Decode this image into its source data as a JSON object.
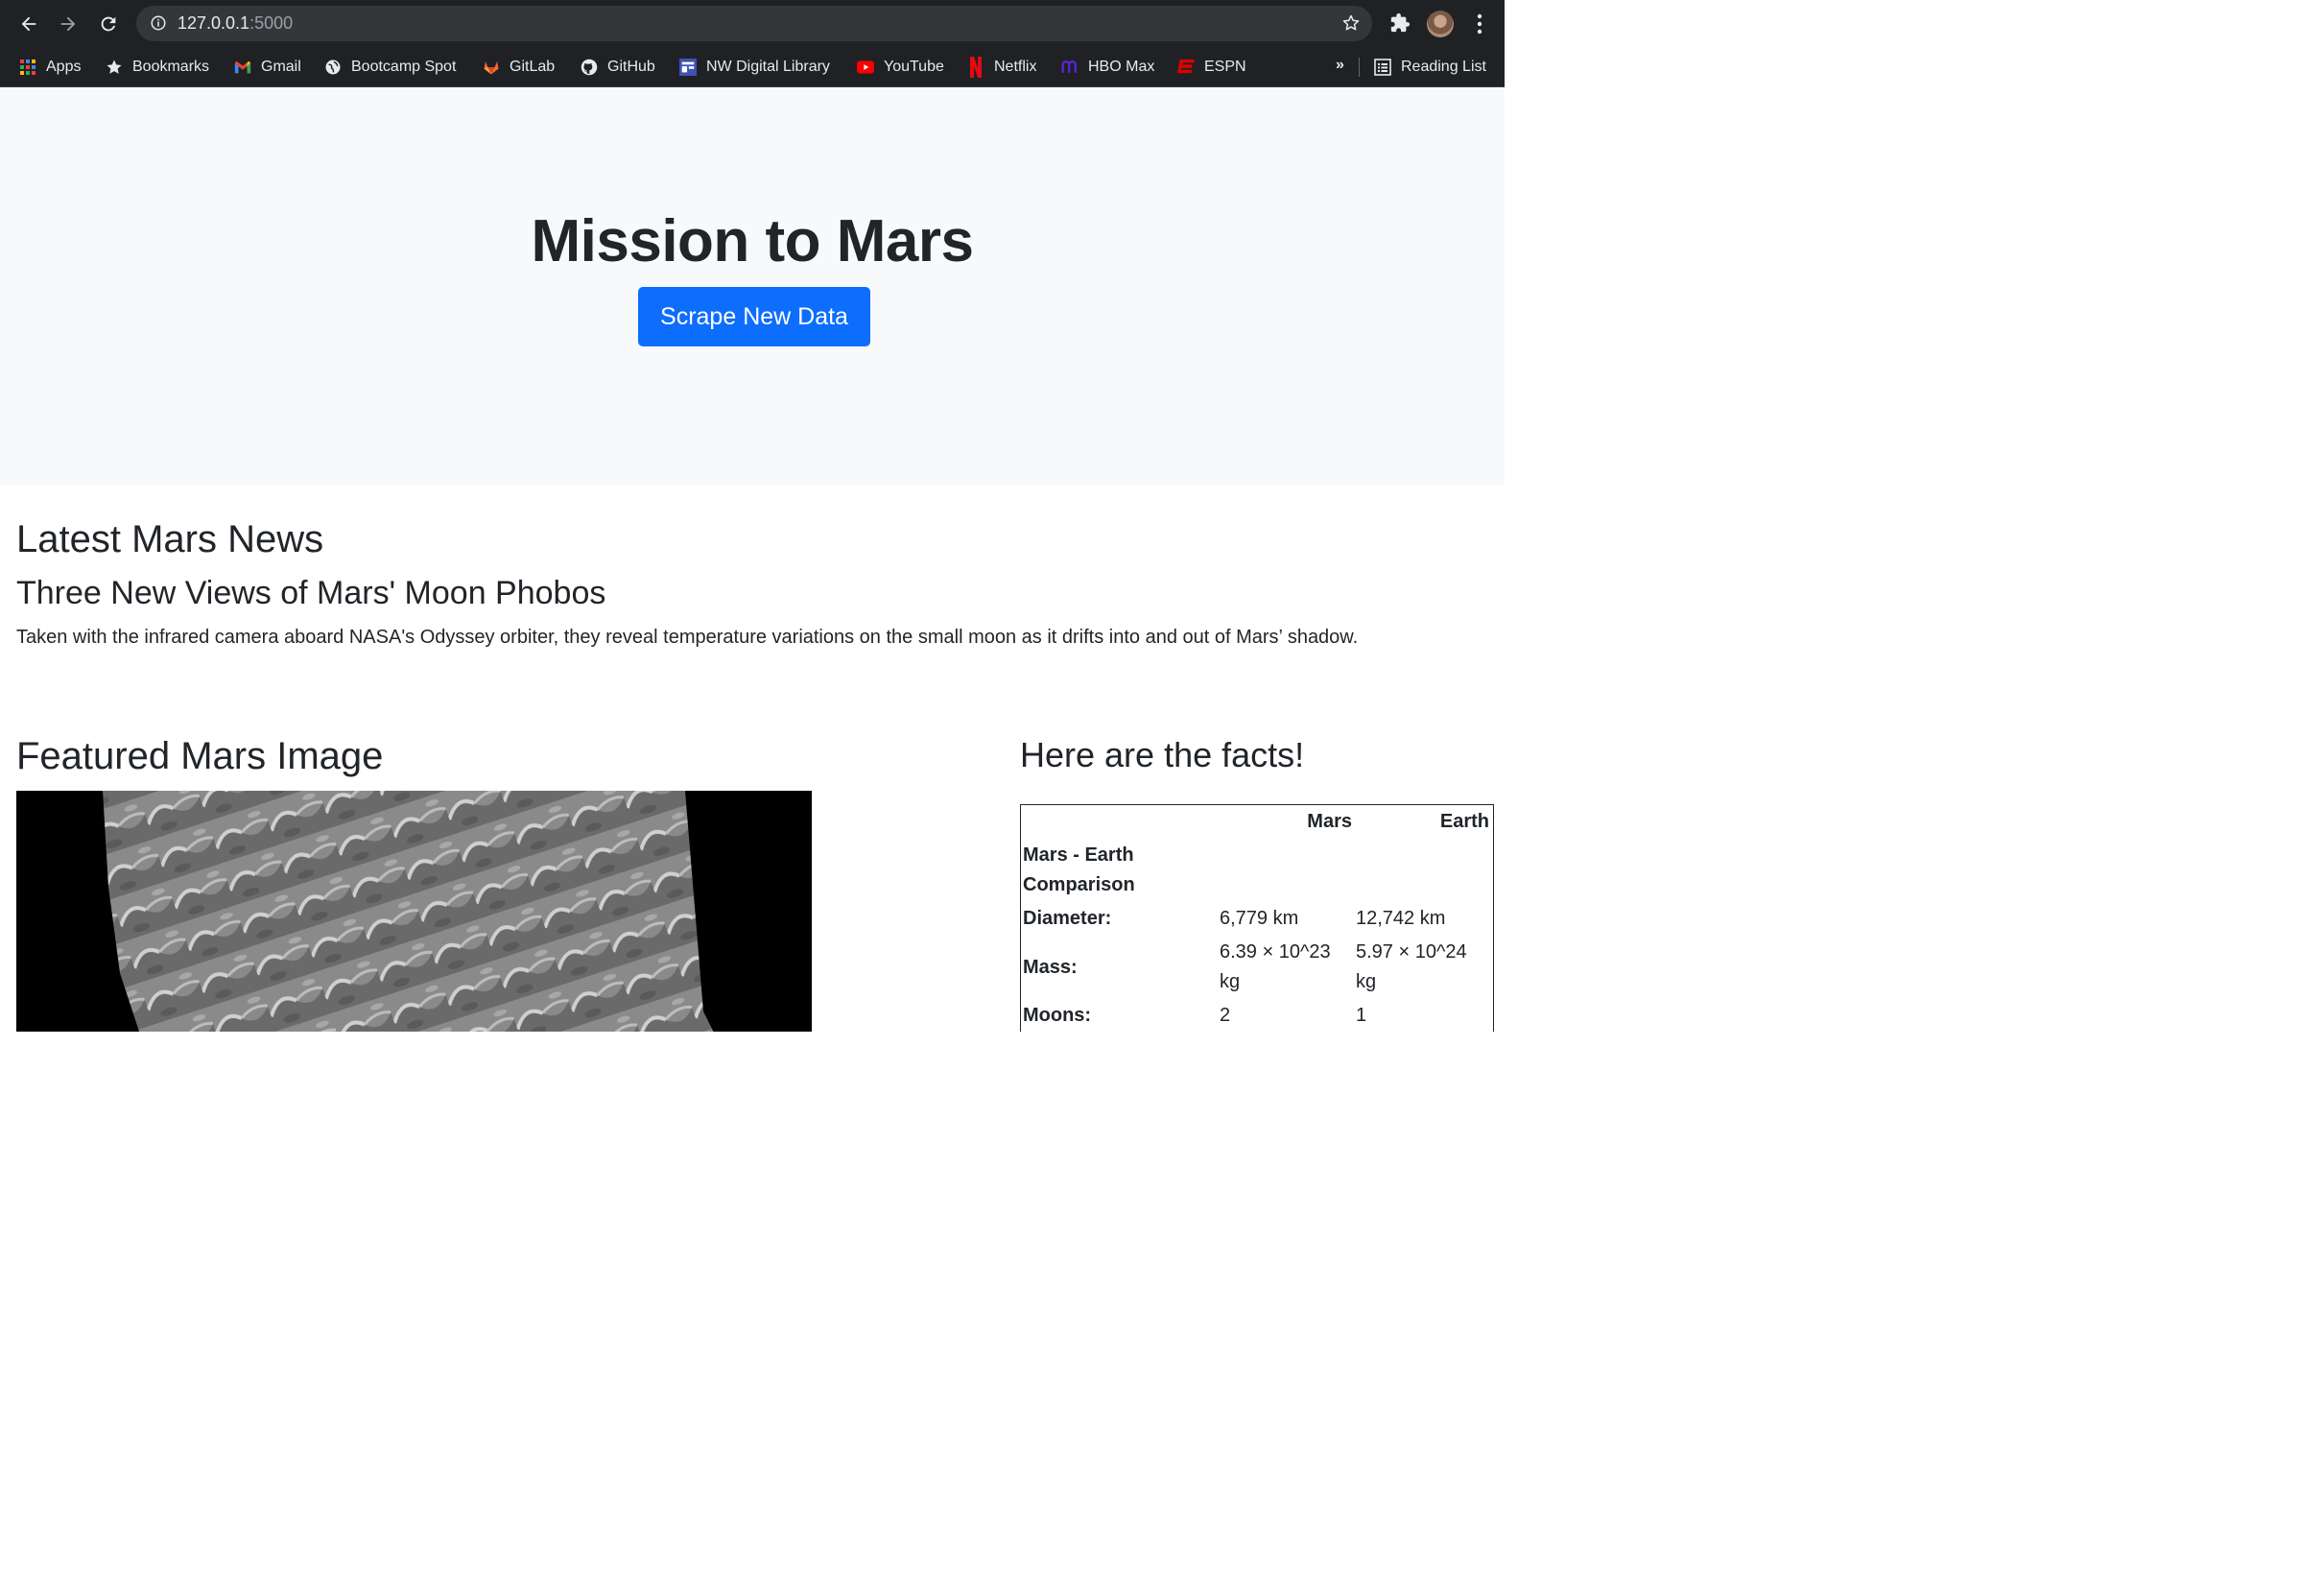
{
  "browser": {
    "url_host": "127.0.0.1",
    "url_port": ":5000",
    "bookmarks": [
      {
        "label": "Apps",
        "icon": "apps-grid-icon"
      },
      {
        "label": "Bookmarks",
        "icon": "star-icon"
      },
      {
        "label": "Gmail",
        "icon": "gmail-icon"
      },
      {
        "label": "Bootcamp Spot",
        "icon": "globe-icon"
      },
      {
        "label": "GitLab",
        "icon": "gitlab-icon"
      },
      {
        "label": "GitHub",
        "icon": "github-icon"
      },
      {
        "label": "NW Digital Library",
        "icon": "library-icon"
      },
      {
        "label": "YouTube",
        "icon": "youtube-icon"
      },
      {
        "label": "Netflix",
        "icon": "netflix-icon"
      },
      {
        "label": "HBO Max",
        "icon": "hbomax-icon"
      },
      {
        "label": "ESPN",
        "icon": "espn-icon"
      }
    ],
    "more_label": "»",
    "reading_list_label": "Reading List"
  },
  "page": {
    "title": "Mission to Mars",
    "scrape_button": "Scrape New Data",
    "news": {
      "heading": "Latest Mars News",
      "title": "Three New Views of Mars' Moon Phobos",
      "teaser": "Taken with the infrared camera aboard NASA's Odyssey orbiter, they reveal temperature variations on the small moon as it drifts into and out of Mars’ shadow."
    },
    "featured_image": {
      "heading": "Featured Mars Image"
    },
    "facts": {
      "heading": "Here are the facts!",
      "columns": [
        "",
        "Mars",
        "Earth"
      ],
      "rows": [
        {
          "label": "Mars - Earth Comparison",
          "mars": "",
          "earth": ""
        },
        {
          "label": "Diameter:",
          "mars": "6,779 km",
          "earth": "12,742 km"
        },
        {
          "label": "Mass:",
          "mars": "6.39 × 10^23 kg",
          "earth": "5.97 × 10^24 kg"
        },
        {
          "label": "Moons:",
          "mars": "2",
          "earth": "1"
        }
      ]
    }
  },
  "colors": {
    "primary_button": "#0d6efd",
    "jumbotron_bg": "#f8f9fa",
    "chrome_bg": "#202124"
  }
}
